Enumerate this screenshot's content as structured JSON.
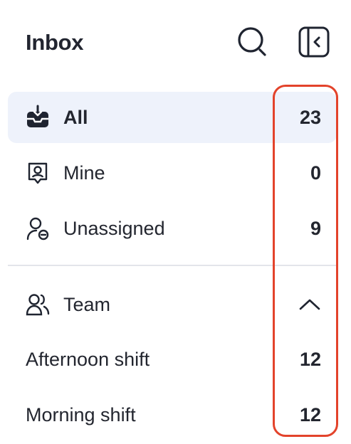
{
  "header": {
    "title": "Inbox",
    "search_icon": "search-icon",
    "collapse_icon": "sidebar-collapse-icon"
  },
  "nav": [
    {
      "label": "All",
      "count": "23",
      "icon": "inbox-tray-icon",
      "active": true
    },
    {
      "label": "Mine",
      "count": "0",
      "icon": "user-badge-icon"
    },
    {
      "label": "Unassigned",
      "count": "9",
      "icon": "user-minus-icon"
    }
  ],
  "team": {
    "label": "Team",
    "icon": "users-icon",
    "toggle_icon": "chevron-up-icon",
    "items": [
      {
        "label": "Afternoon shift",
        "count": "12"
      },
      {
        "label": "Morning shift",
        "count": "12"
      }
    ]
  },
  "colors": {
    "active_bg": "#eef2fb",
    "highlight_border": "#e3432b",
    "text": "#23262f"
  }
}
